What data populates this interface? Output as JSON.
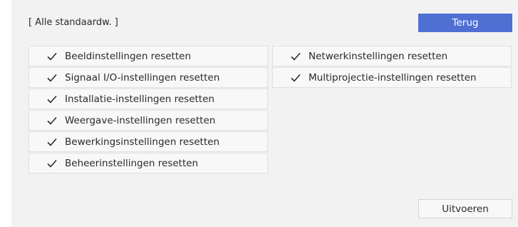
{
  "header": {
    "title": "[ Alle standaardw. ]"
  },
  "buttons": {
    "back_label": "Terug",
    "execute_label": "Uitvoeren"
  },
  "left_items": [
    {
      "label": "Beeldinstellingen resetten",
      "checked": true
    },
    {
      "label": "Signaal I/O-instellingen resetten",
      "checked": true
    },
    {
      "label": "Installatie-instellingen resetten",
      "checked": true
    },
    {
      "label": "Weergave-instellingen resetten",
      "checked": true
    },
    {
      "label": "Bewerkingsinstellingen resetten",
      "checked": true
    },
    {
      "label": "Beheerinstellingen resetten",
      "checked": true
    }
  ],
  "right_items": [
    {
      "label": "Netwerkinstellingen resetten",
      "checked": true
    },
    {
      "label": "Multiprojectie-instellingen resetten",
      "checked": true
    }
  ],
  "icons": {
    "check": "checkmark-icon"
  },
  "colors": {
    "accent": "#4f6fd3",
    "panel_bg": "#f2f2f2",
    "item_bg": "#f8f8f8"
  }
}
